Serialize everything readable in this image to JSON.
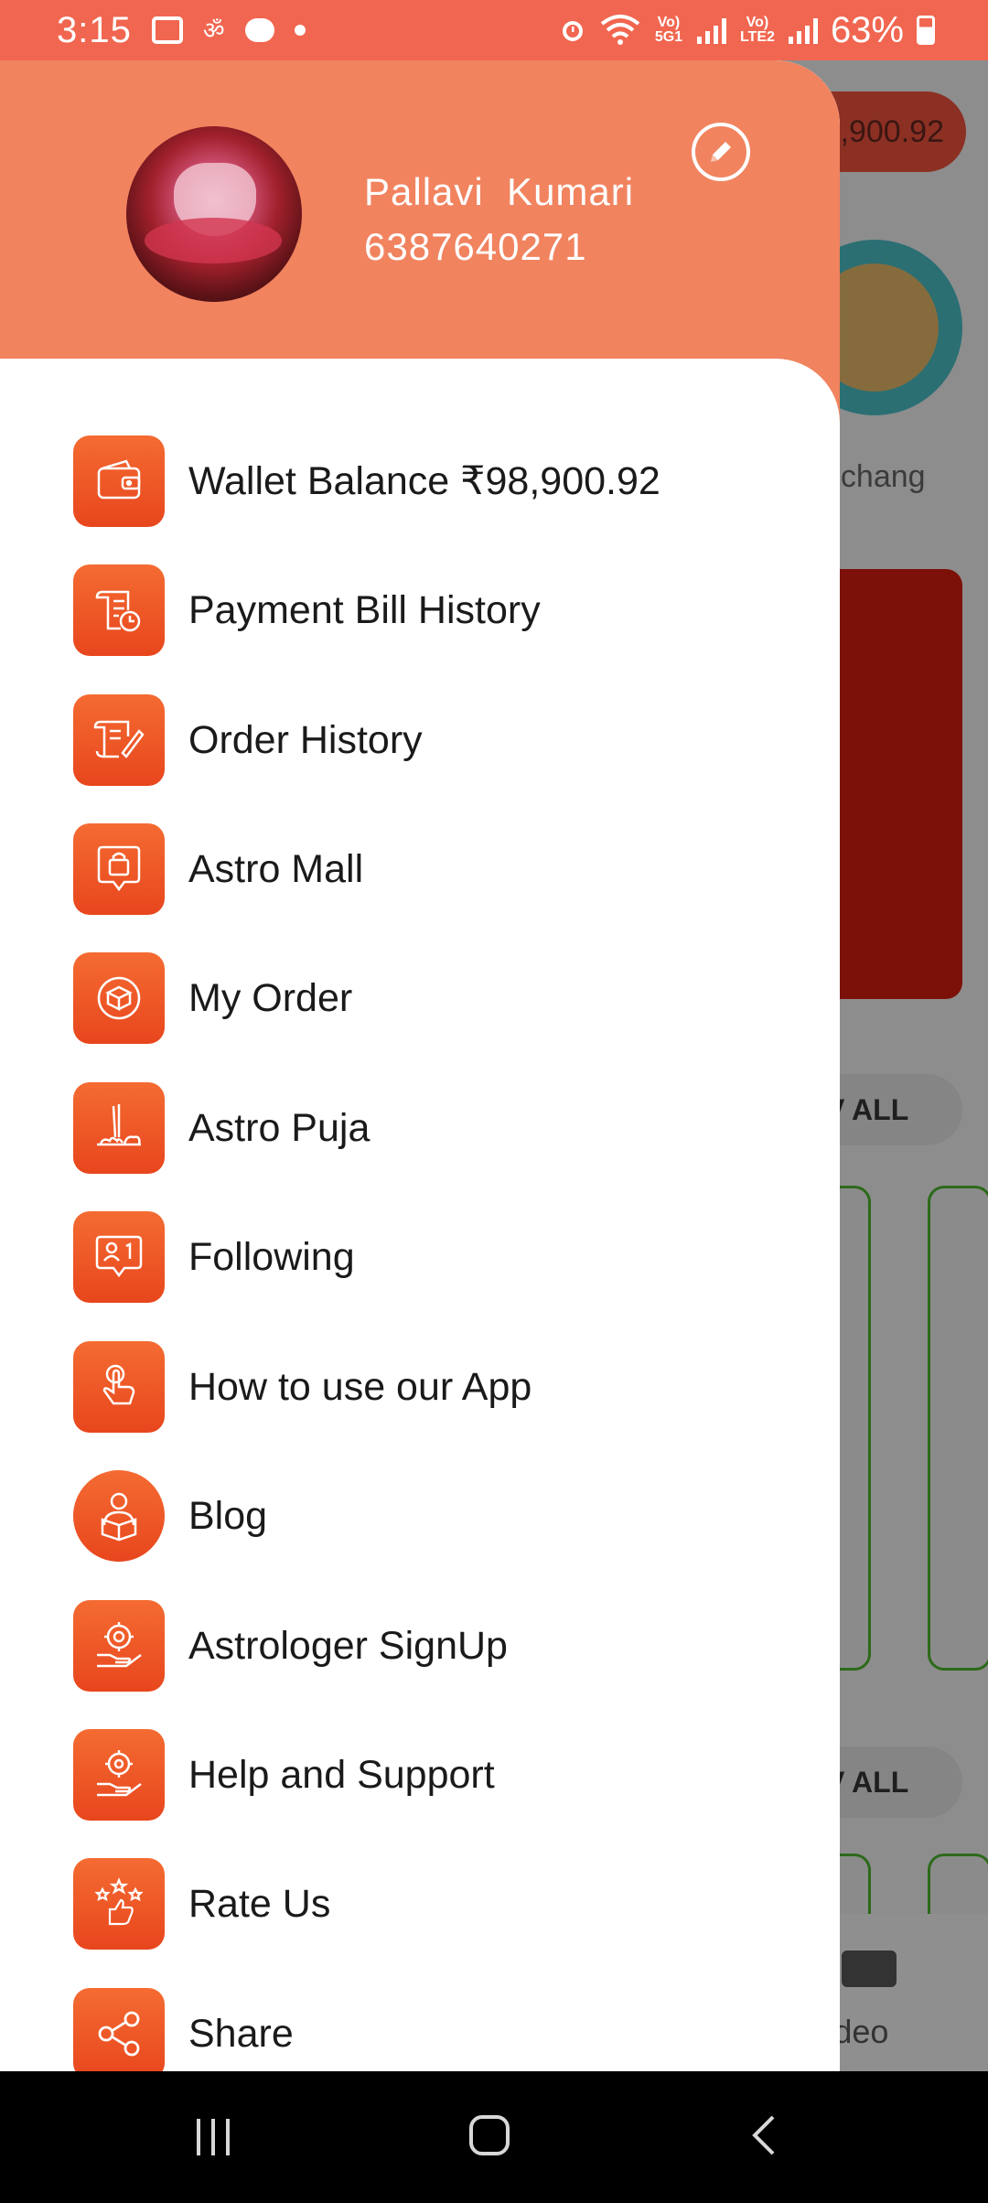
{
  "status_bar": {
    "time": "3:15",
    "battery_text": "63%",
    "net1_label": "Vo) 5G1",
    "net2_label": "Vo) LTE2",
    "icons": [
      "gallery-icon",
      "om-icon",
      "chat-icon",
      "dot-icon",
      "alarm-icon",
      "wifi-icon",
      "signal-icon",
      "signal-icon",
      "battery-icon"
    ]
  },
  "background": {
    "wallet_pill": ",900.92",
    "panchang_label": "nchang",
    "view_all_1": "V ALL",
    "view_all_2": "V ALL",
    "video_label": "Video"
  },
  "drawer": {
    "header_color": "#f1835f",
    "accent": "#ee5624",
    "user": {
      "name": "Pallavi  Kumari",
      "phone": "6387640271"
    },
    "items": [
      {
        "label": "Wallet Balance ₹98,900.92",
        "icon": "wallet-icon"
      },
      {
        "label": "Payment Bill History",
        "icon": "bill-history-icon"
      },
      {
        "label": "Order History",
        "icon": "order-history-icon"
      },
      {
        "label": "Astro Mall",
        "icon": "shopping-bag-icon"
      },
      {
        "label": "My Order",
        "icon": "package-icon"
      },
      {
        "label": "Astro Puja",
        "icon": "puja-icon"
      },
      {
        "label": "Following",
        "icon": "following-icon"
      },
      {
        "label": "How to use our App",
        "icon": "tap-hand-icon"
      },
      {
        "label": "Blog",
        "icon": "blog-reader-icon"
      },
      {
        "label": "Astrologer SignUp",
        "icon": "astrologer-icon"
      },
      {
        "label": "Help and Support",
        "icon": "support-icon"
      },
      {
        "label": "Rate Us",
        "icon": "rate-stars-icon"
      },
      {
        "label": "Share",
        "icon": "share-icon"
      }
    ]
  },
  "nav_bar": {
    "icons": [
      "recents-icon",
      "home-icon",
      "back-icon"
    ]
  }
}
